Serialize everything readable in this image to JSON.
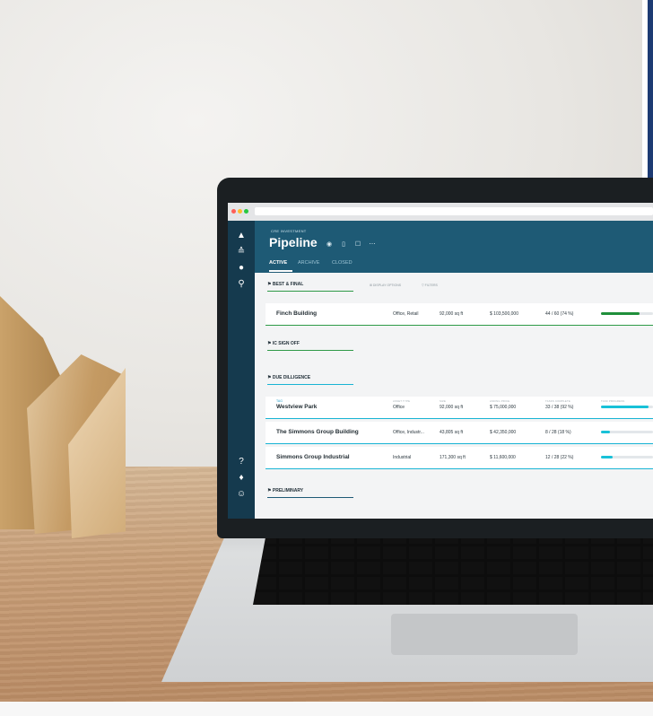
{
  "app": {
    "overline": "CRE INVESTMENT",
    "title": "Pipeline",
    "tabs": [
      "ACTIVE",
      "ARCHIVE",
      "CLOSED"
    ],
    "toolbar": {
      "display_options": "DISPLAY OPTIONS",
      "filters": "FILTERS"
    }
  },
  "columns": {
    "asset_type": "ASSET TYPE",
    "size": "SIZE",
    "asking_price": "ASKING PRICE",
    "tasks_complete": "TASKS COMPLETE",
    "task_progress": "TASK PROGRESS"
  },
  "sections": [
    {
      "label": "BEST & FINAL",
      "accent": "#2e9a47"
    },
    {
      "label": "IC SIGN OFF",
      "accent": "#2e9a47"
    },
    {
      "label": "DUE DILLIGENCE",
      "accent": "#18b4d4"
    },
    {
      "label": "PRELIMINARY",
      "accent": "#1e5a75"
    }
  ],
  "rows": [
    {
      "tag": "",
      "name": "Finch Building",
      "type": "Office, Retail",
      "size": "92,000 sq ft",
      "price": "$ 103,500,000",
      "tasks": "44 / 60  (74 %)",
      "progress": 0.74,
      "color": "#1f8f3a"
    },
    {
      "tag": "TAG",
      "name": "Westview Park",
      "type": "Office",
      "size": "92,000 sq ft",
      "price": "$ 75,000,000",
      "tasks": "33 / 38  (92 %)",
      "progress": 0.92,
      "color": "#18c1d8"
    },
    {
      "tag": "",
      "name": "The Simmons Group Building",
      "type": "Office, Industr...",
      "size": "43,805 sq ft",
      "price": "$ 42,350,000",
      "tasks": "8 / 28  (18 %)",
      "progress": 0.18,
      "color": "#18c1d8"
    },
    {
      "tag": "",
      "name": "Simmons Group Industrial",
      "type": "Industrial",
      "size": "171,300 sq ft",
      "price": "$ 11,600,000",
      "tasks": "12 / 28  (22 %)",
      "progress": 0.22,
      "color": "#18c1d8"
    }
  ],
  "icons": {
    "rail": [
      "logo-icon",
      "layers-icon",
      "settings-icon",
      "search-icon",
      "help-icon",
      "notifications-icon",
      "user-icon"
    ],
    "header": [
      "view-icon",
      "map-icon",
      "edit-icon",
      "more-icon"
    ]
  },
  "browser_dots": [
    "#ff5f57",
    "#febc2e",
    "#28c840"
  ]
}
